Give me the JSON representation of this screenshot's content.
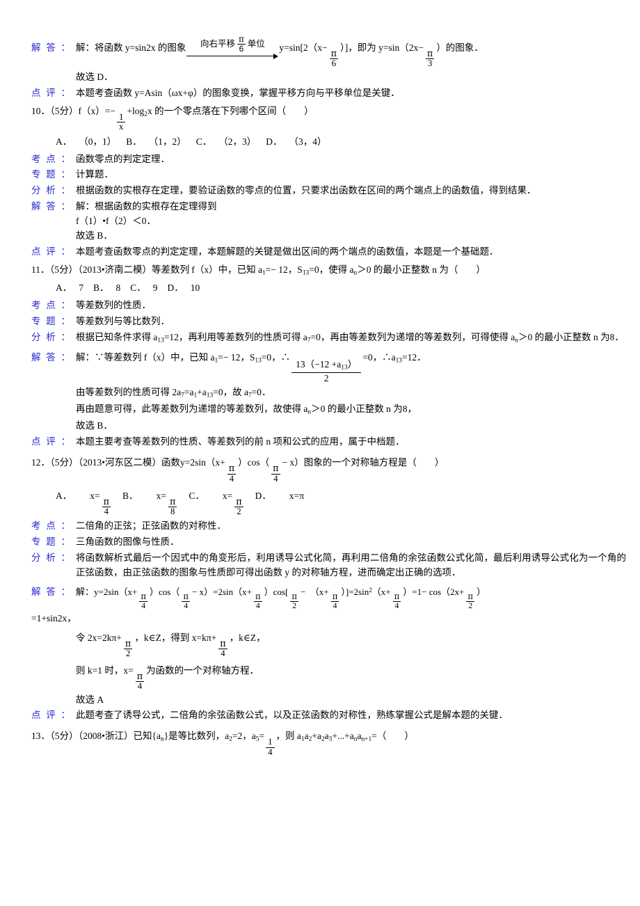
{
  "document": {
    "type": "math-solution-sheet",
    "label_colon": "：",
    "labels": {
      "kaodian": "考点",
      "zhuanti": "专题",
      "fenxi": "分析",
      "jieda": "解答",
      "dianping": "点评"
    },
    "label_color": "#2a2ad0"
  },
  "q9_tail": {
    "jieda_label": "解答",
    "jieda_prefix": "解：将函数 y=sin2x 的图象",
    "arrow_above_pre": "向右平移",
    "arrow_frac_num": "π",
    "arrow_frac_den": "6",
    "arrow_above_post": "单位",
    "jieda_mid": "y=sin[2（x−",
    "frac2_num": "π",
    "frac2_den": "6",
    "jieda_mid2": "）]，即为 y=sin（2x−",
    "frac3_num": "π",
    "frac3_den": "3",
    "jieda_end": "）的图象．",
    "answer_line": "故选 D．",
    "dianping_label": "点评",
    "dianping_text": "本题考查函数 y=Asin（ωx+φ）的图象变换，掌握平移方向与平移单位是关键．"
  },
  "q10": {
    "number": "10",
    "score": "（5分）",
    "stem_a": "f（x）=−",
    "stem_frac_num": "1",
    "stem_frac_den": "x",
    "stem_b": "+log",
    "stem_sub": "2",
    "stem_c": "x 的一个零点落在下列哪个区间（",
    "stem_d": "）",
    "options": [
      {
        "key": "A．",
        "value": "（0，1）"
      },
      {
        "key": "B．",
        "value": "（1，2）"
      },
      {
        "key": "C．",
        "value": "（2，3）"
      },
      {
        "key": "D．",
        "value": "（3，4）"
      }
    ],
    "kaodian": "函数零点的判定定理．",
    "zhuanti": "计算题．",
    "fenxi": "根据函数的实根存在定理，要验证函数的零点的位置，只要求出函数在区间的两个端点上的函数值，得到结果．",
    "jieda_line1": "解：根据函数的实根存在定理得到",
    "jieda_line2": "f（1）•f（2）＜0．",
    "jieda_line3": "故选 B．",
    "dianping": "本题考查函数零点的判定定理，本题解题的关键是做出区间的两个端点的函数值，本题是一个基础题．"
  },
  "q11": {
    "number": "11",
    "score": "（5分）",
    "source": "（2013•济南二模）",
    "stem_a": "等差数列 f（x）中，已知 a",
    "stem_sub1": "1",
    "stem_b": "=− 12，S",
    "stem_sub2": "13",
    "stem_c": "=0，使得 a",
    "stem_sub3": "n",
    "stem_d": "＞0 的最小正整数 n 为（",
    "stem_e": "）",
    "options": [
      {
        "key": "A．",
        "value": "7"
      },
      {
        "key": "B．",
        "value": "8"
      },
      {
        "key": "C．",
        "value": "9"
      },
      {
        "key": "D．",
        "value": "10"
      }
    ],
    "kaodian": "等差数列的性质．",
    "zhuanti": "等差数列与等比数列．",
    "fenxi_a": "根据已知条件求得 a",
    "fenxi_sub1": "13",
    "fenxi_b": "=12，再利用等差数列的性质可得 a",
    "fenxi_sub2": "7",
    "fenxi_c": "=0，再由等差数列为递增的等差数列，可得使得 a",
    "fenxi_sub3": "n",
    "fenxi_d": "＞0 的最小正整数 n 为8．",
    "jieda_a": "解：∵等差数列 f（x）中，已知 a",
    "jieda_sub1": "1",
    "jieda_b": "=− 12，S",
    "jieda_sub2": "13",
    "jieda_c": "=0，∴",
    "jieda_frac_num_a": "13（−12 +a",
    "jieda_frac_num_sub": "13",
    "jieda_frac_num_b": "）",
    "jieda_frac_den": "2",
    "jieda_d": "=0，∴a",
    "jieda_sub3": "13",
    "jieda_e": "=12．",
    "jieda_line2_a": "由等差数列的性质可得 2a",
    "jieda_l2_sub1": "7",
    "jieda_line2_b": "=a",
    "jieda_l2_sub2": "1",
    "jieda_line2_c": "+a",
    "jieda_l2_sub3": "13",
    "jieda_line2_d": "=0，故 a",
    "jieda_l2_sub4": "7",
    "jieda_line2_e": "=0．",
    "jieda_line3_a": "再由题意可得，此等差数列为递增的等差数列，故使得 a",
    "jieda_l3_sub": "n",
    "jieda_line3_b": "＞0 的最小正整数 n 为8，",
    "jieda_line4": "故选 B．",
    "dianping": "本题主要考查等差数列的性质、等差数列的前 n 项和公式的应用，属于中档题．"
  },
  "q12": {
    "number": "12",
    "score": "（5分）",
    "source": "（2013•河东区二模）",
    "stem_a": "函数y=2sin（x+",
    "stem_f1_num": "π",
    "stem_f1_den": "4",
    "stem_b": "）cos（",
    "stem_f2_num": "π",
    "stem_f2_den": "4",
    "stem_c": "− x）图象的一个对称轴方程是（",
    "stem_d": "）",
    "options": [
      {
        "key": "A．",
        "lhs": "x=",
        "num": "π",
        "den": "4"
      },
      {
        "key": "B．",
        "lhs": "x=",
        "num": "π",
        "den": "8"
      },
      {
        "key": "C．",
        "lhs": "x=",
        "num": "π",
        "den": "2"
      },
      {
        "key": "D．",
        "lhs": "x=π",
        "num": "",
        "den": ""
      }
    ],
    "kaodian": "二倍角的正弦；正弦函数的对称性．",
    "zhuanti": "三角函数的图像与性质．",
    "fenxi": "将函数解析式最后一个因式中的角变形后，利用诱导公式化简，再利用二倍角的余弦函数公式化简，最后利用诱导公式化为一个角的正弦函数，由正弦函数的图象与性质即可得出函数 y 的对称轴方程，进而确定出正确的选项．",
    "jieda_p1": "解：y=2sin（x+",
    "jieda_p2": "）cos（",
    "jieda_p3": "− x）=2sin（x+",
    "jieda_p4": "）cos[",
    "jieda_p5": "−　（x+",
    "jieda_p6": "）]=2sin",
    "jieda_sup": "2",
    "jieda_p7": "（x+",
    "jieda_p8": "）=1− cos（2x+",
    "jieda_p9": "）",
    "jieda_line2": "=1+sin2x，",
    "jieda_line3_a": "令 2x=2kπ+",
    "jieda_l3_num": "π",
    "jieda_l3_den": "2",
    "jieda_line3_b": "，k∈Z，得到 x=kπ+",
    "jieda_l3_num2": "π",
    "jieda_l3_den2": "4",
    "jieda_line3_c": "，k∈Z，",
    "jieda_line4_a": "则 k=1 时，x=",
    "jieda_l4_num": "π",
    "jieda_l4_den": "4",
    "jieda_line4_b": "为函数的一个对称轴方程．",
    "jieda_line5": "故选 A",
    "dianping": "此题考查了诱导公式，二倍角的余弦函数公式，以及正弦函数的对称性，熟练掌握公式是解本题的关键．",
    "frac_pi": "π",
    "frac_4": "4",
    "frac_2": "2"
  },
  "q13": {
    "number": "13",
    "score": "（5分）",
    "source": "（2008•浙江）",
    "stem_a": "已知{a",
    "stem_sub1": "n",
    "stem_b": "}是等比数列，a",
    "stem_sub2": "2",
    "stem_c": "=2，a",
    "stem_sub3": "5",
    "stem_d": "=",
    "stem_frac_num": "1",
    "stem_frac_den": "4",
    "stem_e": "，则 a",
    "stem_sub4": "1",
    "stem_f": "a",
    "stem_sub5": "2",
    "stem_g": "+a",
    "stem_sub6": "2",
    "stem_h": "a",
    "stem_sub7": "3",
    "stem_i": "+...+a",
    "stem_sub8": "n",
    "stem_j": "a",
    "stem_sub9": "n+1",
    "stem_k": "=（",
    "stem_l": "）"
  }
}
